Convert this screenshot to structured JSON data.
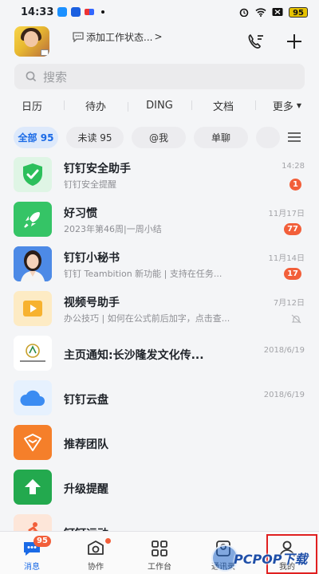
{
  "status_bar": {
    "time": "14:33",
    "battery": "95"
  },
  "header": {
    "work_status": "添加工作状态...",
    "work_status_caret": ">"
  },
  "search": {
    "placeholder": "搜索"
  },
  "quick_tabs": [
    {
      "label": "日历"
    },
    {
      "label": "待办"
    },
    {
      "label": "DING"
    },
    {
      "label": "文档"
    },
    {
      "label": "更多"
    }
  ],
  "filters": [
    {
      "label": "全部 95",
      "active": true
    },
    {
      "label": "未读 95"
    },
    {
      "label": "@我"
    },
    {
      "label": "单聊"
    }
  ],
  "conversations": [
    {
      "title": "钉钉安全助手",
      "subtitle": "钉钉安全提醒",
      "time": "14:28",
      "badge": "1",
      "icon": "shield-check-icon",
      "color": "#2cbf5b"
    },
    {
      "title": "好习惯",
      "subtitle": "2023年第46周|一周小结",
      "time": "11月17日",
      "badge": "77",
      "icon": "rocket-icon",
      "color": "#35c466"
    },
    {
      "title": "钉钉小秘书",
      "subtitle": "钉钉 Teambition 新功能 | 支持在任务...",
      "time": "11月14日",
      "badge": "17",
      "icon": "secretary-avatar",
      "color": "#3a78d8"
    },
    {
      "title": "视频号助手",
      "subtitle": "办公技巧 | 如何在公式前后加字，点击查...",
      "time": "7月12日",
      "icon": "play-icon",
      "color": "#f7b22f",
      "muted": true
    },
    {
      "title": "主页通知:长沙隆发文化传...",
      "time": "2018/6/19",
      "icon": "company-logo",
      "color": "#c8a02a"
    },
    {
      "title": "钉钉云盘",
      "time": "2018/6/19",
      "icon": "cloud-icon",
      "color": "#3b8cf2"
    },
    {
      "title": "推荐团队",
      "icon": "team-icon",
      "color": "#f57f2a"
    },
    {
      "title": "升级提醒",
      "icon": "upgrade-arrow-icon",
      "color": "#23a94e"
    },
    {
      "title": "钉钉运动",
      "icon": "runner-icon",
      "color": "#f25f3a"
    }
  ],
  "tabbar": {
    "items": [
      {
        "label": "消息",
        "badge": "95",
        "active": true
      },
      {
        "label": "协作"
      },
      {
        "label": "工作台"
      },
      {
        "label": "通讯录"
      },
      {
        "label": "我的"
      }
    ]
  },
  "watermark": {
    "text": "PCPOP下载"
  },
  "colors": {
    "accent": "#1a6ae6",
    "badge": "#f25f3a",
    "highlight_box": "#e02020"
  }
}
